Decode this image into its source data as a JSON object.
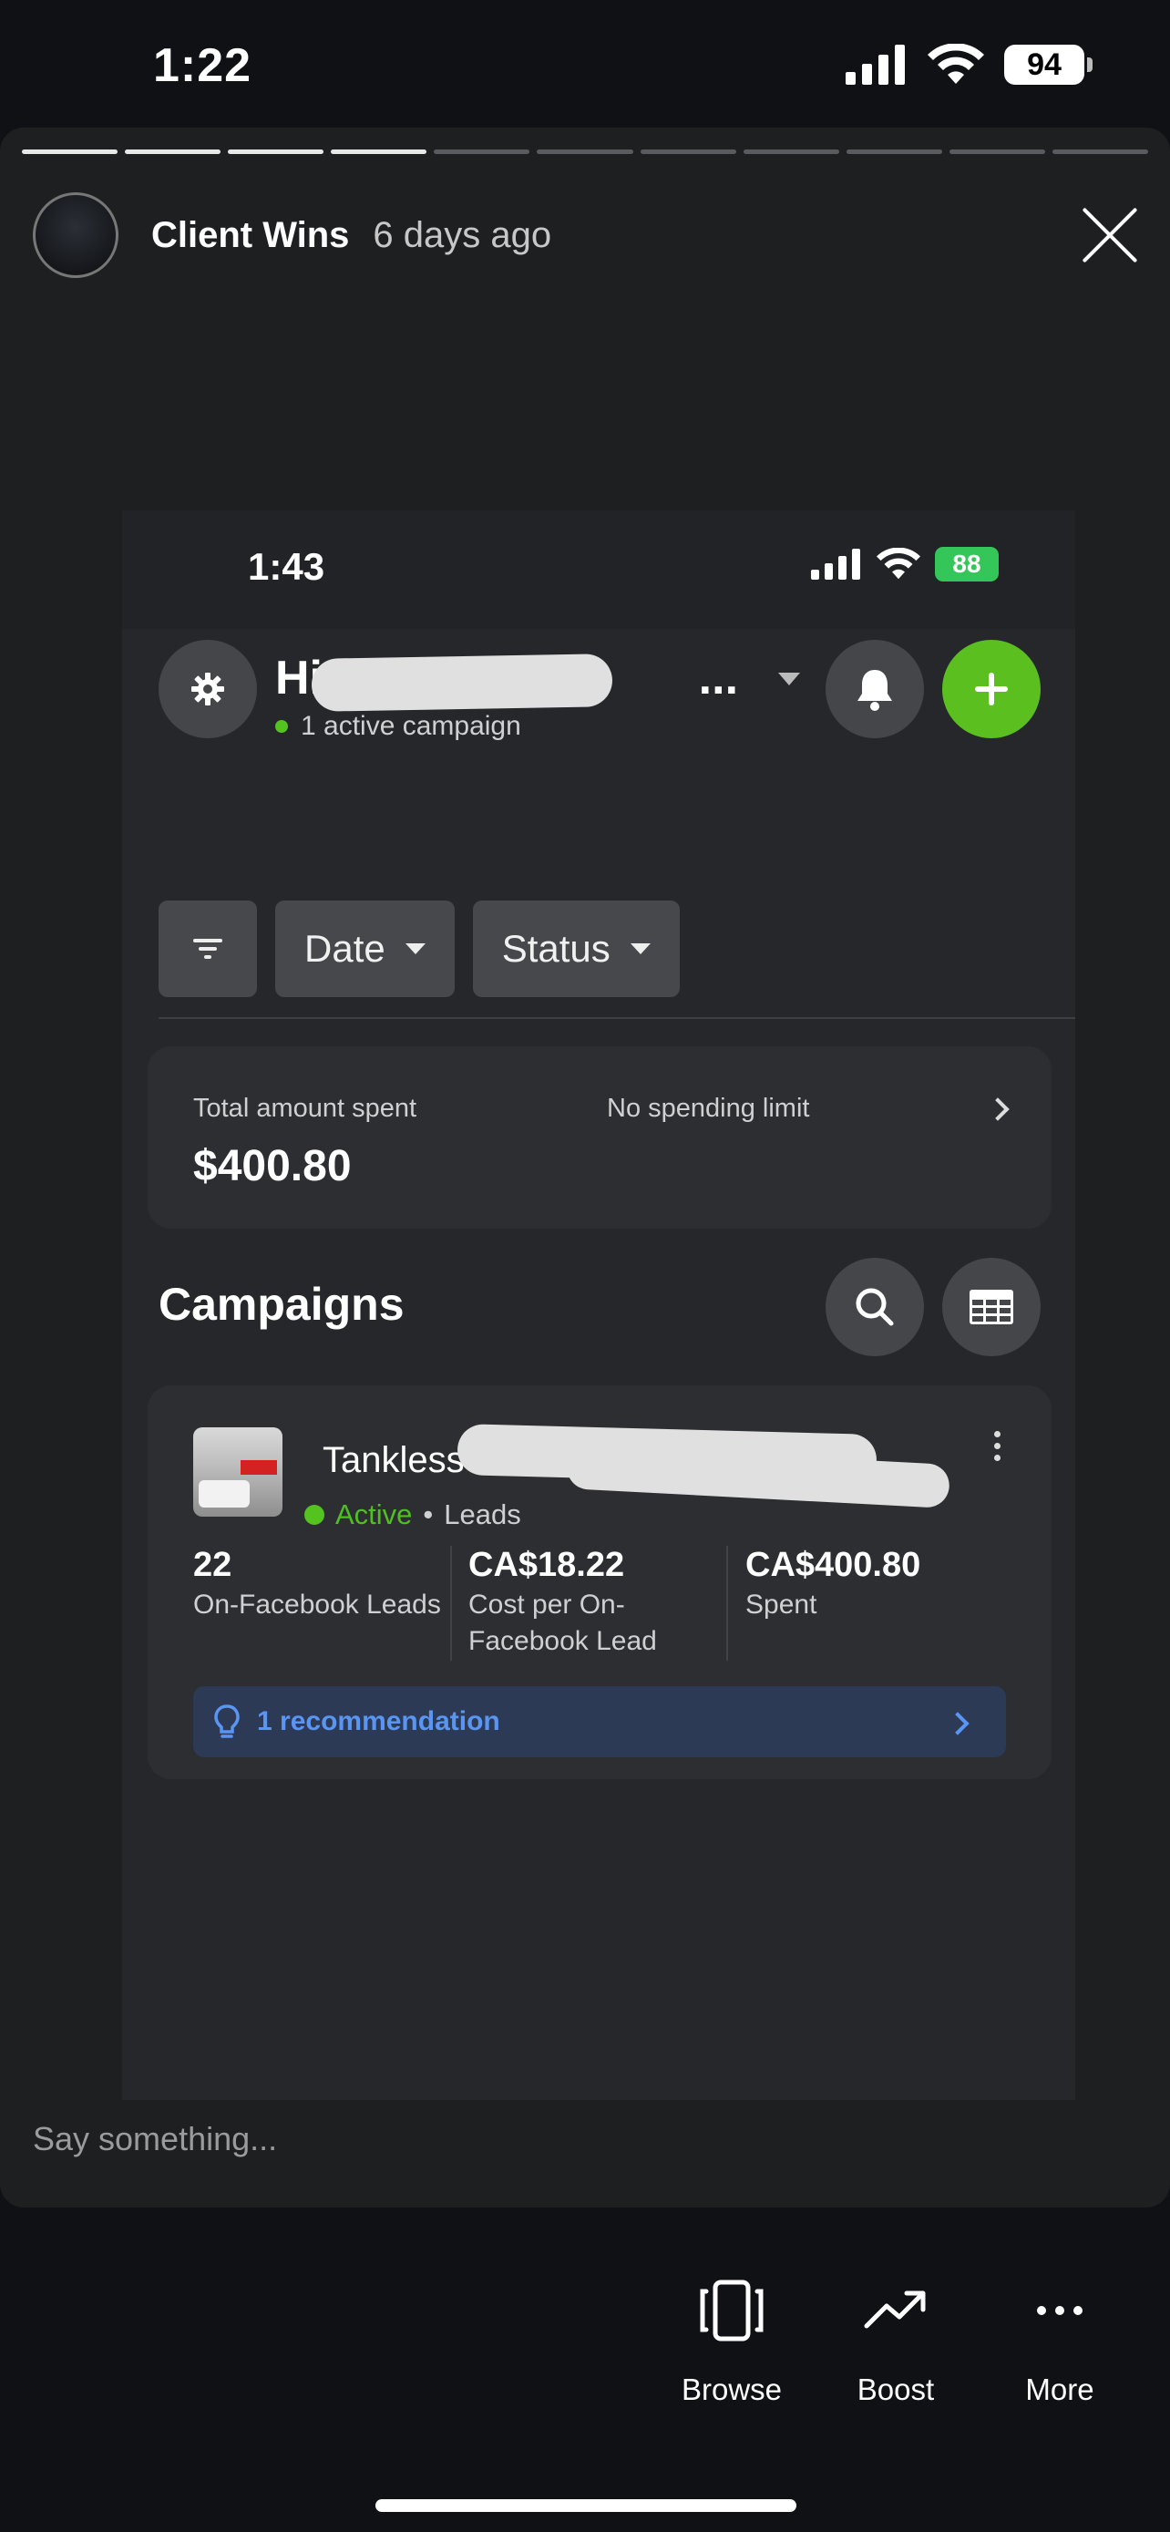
{
  "status_bar": {
    "time": "1:22",
    "battery": "94"
  },
  "story": {
    "author": "Client Wins",
    "posted": "6 days ago",
    "segments": [
      1,
      1,
      1,
      1,
      0,
      0,
      0,
      0,
      0,
      0,
      0
    ],
    "reply_placeholder": "Say something..."
  },
  "inner": {
    "status": {
      "time": "1:43",
      "battery": "88"
    },
    "account": {
      "name": "High P",
      "name_suffix": "...",
      "active_text": "1 active campaign"
    },
    "filters": {
      "date": "Date",
      "status": "Status"
    },
    "spend": {
      "label": "Total amount spent",
      "value": "$400.80",
      "limit": "No spending limit"
    },
    "campaigns_title": "Campaigns",
    "campaign": {
      "name": "Tankless",
      "status": "Active",
      "type": "Leads",
      "metrics": [
        {
          "value": "22",
          "label": "On-Facebook Leads"
        },
        {
          "value": "CA$18.22",
          "label": "Cost per On-Facebook Lead"
        },
        {
          "value": "CA$400.80",
          "label": "Spent"
        }
      ],
      "recommendation": "1 recommendation"
    }
  },
  "actions": {
    "browse": "Browse",
    "boost": "Boost",
    "more": "More"
  },
  "colors": {
    "accent_green": "#5bbf20",
    "link_blue": "#5a95f2"
  }
}
